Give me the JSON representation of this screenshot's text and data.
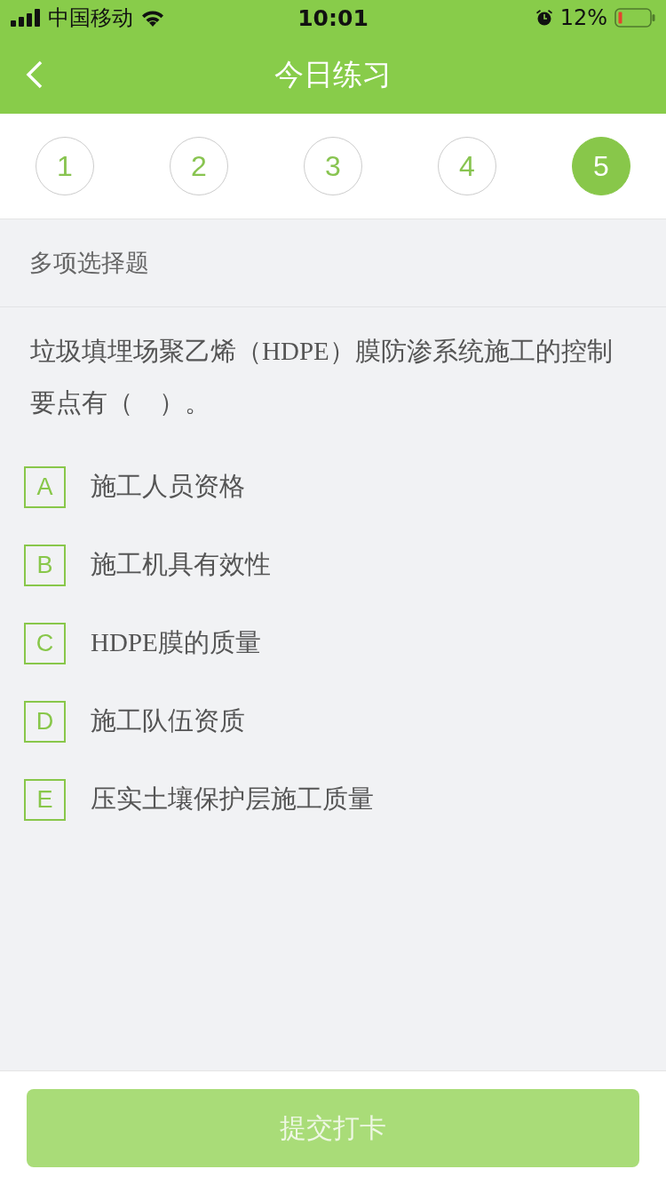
{
  "status_bar": {
    "carrier": "中国移动",
    "time": "10:01",
    "battery_percent": "12%"
  },
  "nav": {
    "title": "今日练习"
  },
  "steps": [
    {
      "label": "1",
      "selected": false
    },
    {
      "label": "2",
      "selected": false
    },
    {
      "label": "3",
      "selected": false
    },
    {
      "label": "4",
      "selected": false
    },
    {
      "label": "5",
      "selected": true
    }
  ],
  "question_type": "多项选择题",
  "question": "垃圾填埋场聚乙烯（HDPE）膜防渗系统施工的控制要点有（　）。",
  "options": [
    {
      "letter": "A",
      "text": "施工人员资格",
      "selected": false
    },
    {
      "letter": "B",
      "text": "施工机具有效性",
      "selected": false
    },
    {
      "letter": "C",
      "text": "HDPE膜的质量",
      "selected": false
    },
    {
      "letter": "D",
      "text": "施工队伍资质",
      "selected": false
    },
    {
      "letter": "E",
      "text": "压实土壤保护层施工质量",
      "selected": false
    }
  ],
  "submit": {
    "label": "提交打卡",
    "disabled": true
  }
}
